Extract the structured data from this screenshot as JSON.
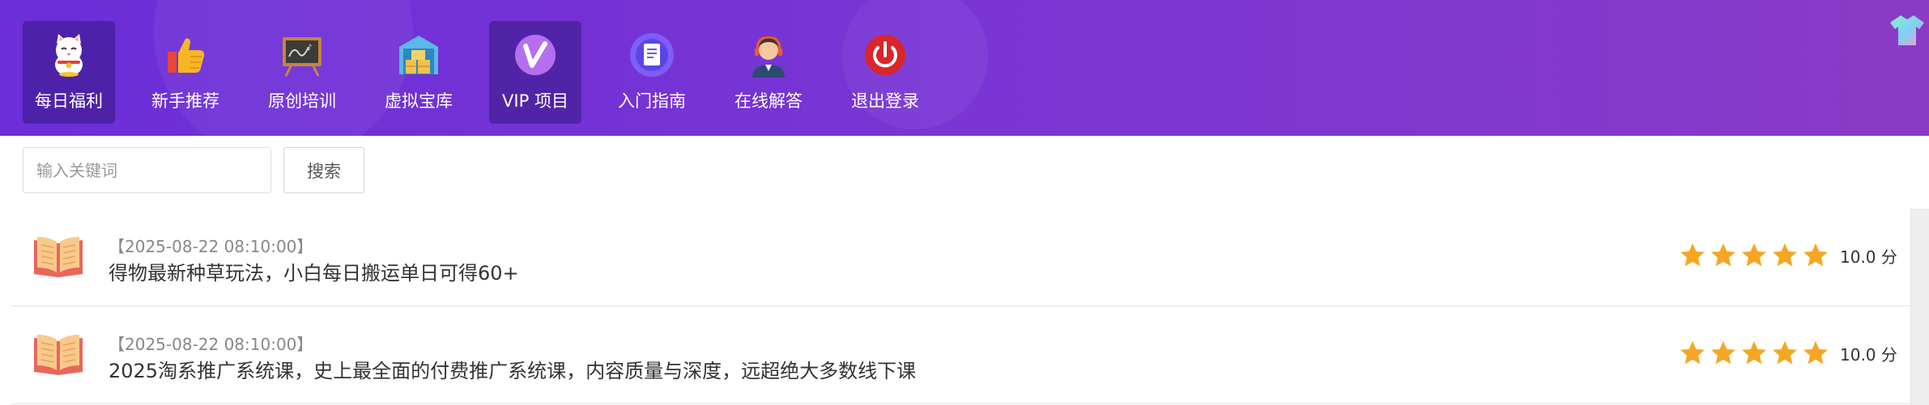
{
  "nav": {
    "items": [
      {
        "label": "每日福利",
        "icon": "lucky-cat-icon",
        "active": true
      },
      {
        "label": "新手推荐",
        "icon": "thumbs-up-icon",
        "active": false
      },
      {
        "label": "原创培训",
        "icon": "blackboard-icon",
        "active": false
      },
      {
        "label": "虚拟宝库",
        "icon": "warehouse-icon",
        "active": false
      },
      {
        "label": "VIP 项目",
        "icon": "vip-v-icon",
        "active": true
      },
      {
        "label": "入门指南",
        "icon": "document-icon",
        "active": false
      },
      {
        "label": "在线解答",
        "icon": "support-agent-icon",
        "active": false
      },
      {
        "label": "退出登录",
        "icon": "power-icon",
        "active": false
      }
    ]
  },
  "search": {
    "placeholder": "输入关键词",
    "value": "",
    "button_label": "搜索"
  },
  "list": [
    {
      "date": "【2025-08-22 08:10:00】",
      "title": "得物最新种草玩法，小白每日搬运单日可得60+",
      "rating_stars": 5,
      "score": "10.0 分"
    },
    {
      "date": "【2025-08-22 08:10:00】",
      "title": "2025淘系推广系统课，史上最全面的付费推广系统课，内容质量与深度，远超绝大多数线下课",
      "rating_stars": 5,
      "score": "10.0 分"
    }
  ],
  "colors": {
    "header_start": "#6b2ed8",
    "header_end": "#8a3ac6",
    "star": "#f5a623"
  }
}
